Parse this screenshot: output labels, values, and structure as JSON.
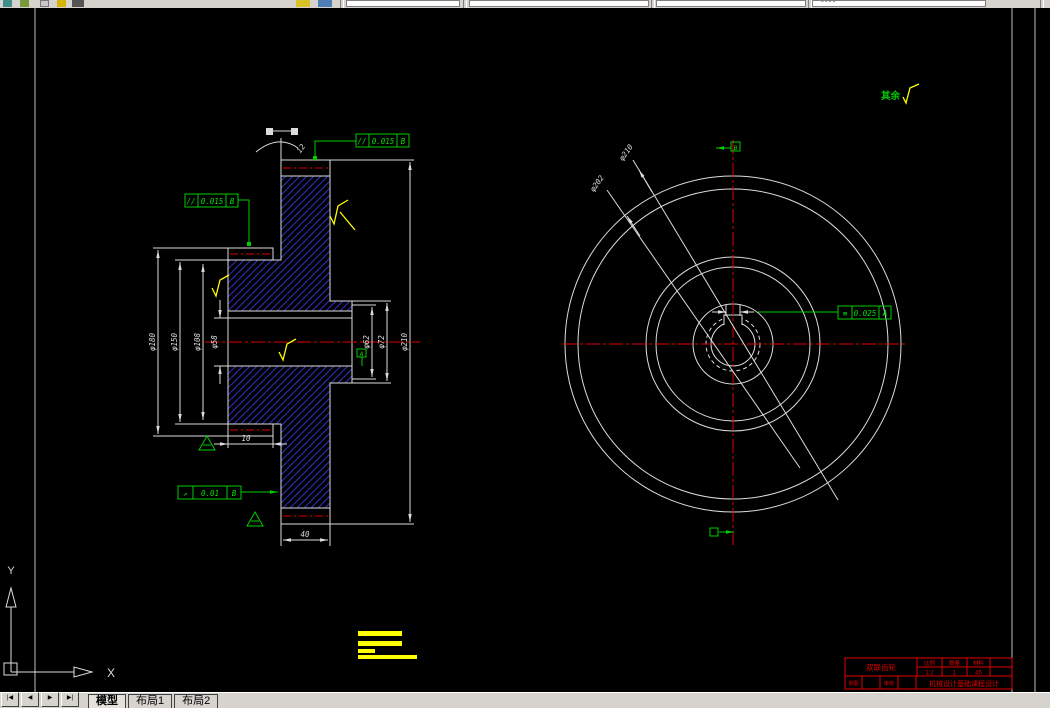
{
  "tabs": {
    "nav_first": "|◀",
    "nav_prev": "◀",
    "nav_next": "▶",
    "nav_last": "▶|",
    "items": [
      {
        "label": "模型",
        "active": true
      },
      {
        "label": "布局1",
        "active": false
      },
      {
        "label": "布局2",
        "active": false
      }
    ]
  },
  "drawing": {
    "note_other": "其余",
    "frames": {
      "par_top": {
        "symbol": "//",
        "value": "0.015",
        "datum": "B"
      },
      "par_left": {
        "symbol": "//",
        "value": "0.015",
        "datum": "B"
      },
      "runout": {
        "symbol": "↗",
        "value": "0.01",
        "datum": "B"
      },
      "symmetry": {
        "symbol": "≡",
        "value": "0.025",
        "datum": "A"
      }
    },
    "dims": {
      "left1": "φ180",
      "left2": "φ150",
      "left3": "φ108",
      "bore": "φ58",
      "right1": "φ62",
      "right2": "φ72",
      "right3": "φ210",
      "width_gear": "40",
      "width_hub": "10",
      "chamfer": "12",
      "circle1": "φ210",
      "circle2": "φ202"
    },
    "datums": {
      "a": "A",
      "b": "B"
    },
    "axes": {
      "x": "X",
      "y": "Y"
    },
    "colors": {
      "line": "#dcdcdc",
      "center": "#e00000",
      "annotation": "#00cc00",
      "roughness": "#ffff00",
      "hatch": "#2e2ec0",
      "titleblock": "#e00000"
    },
    "title_block": {
      "part_name": "双联齿轮",
      "col_scale": "比例",
      "col_qty": "数量",
      "col_mat": "材料",
      "val_scale": "1:2",
      "val_qty": "1",
      "val_mat": "45",
      "cell_draw": "制图",
      "cell_check": "审核",
      "footer": "机械设计基础课程设计"
    }
  }
}
